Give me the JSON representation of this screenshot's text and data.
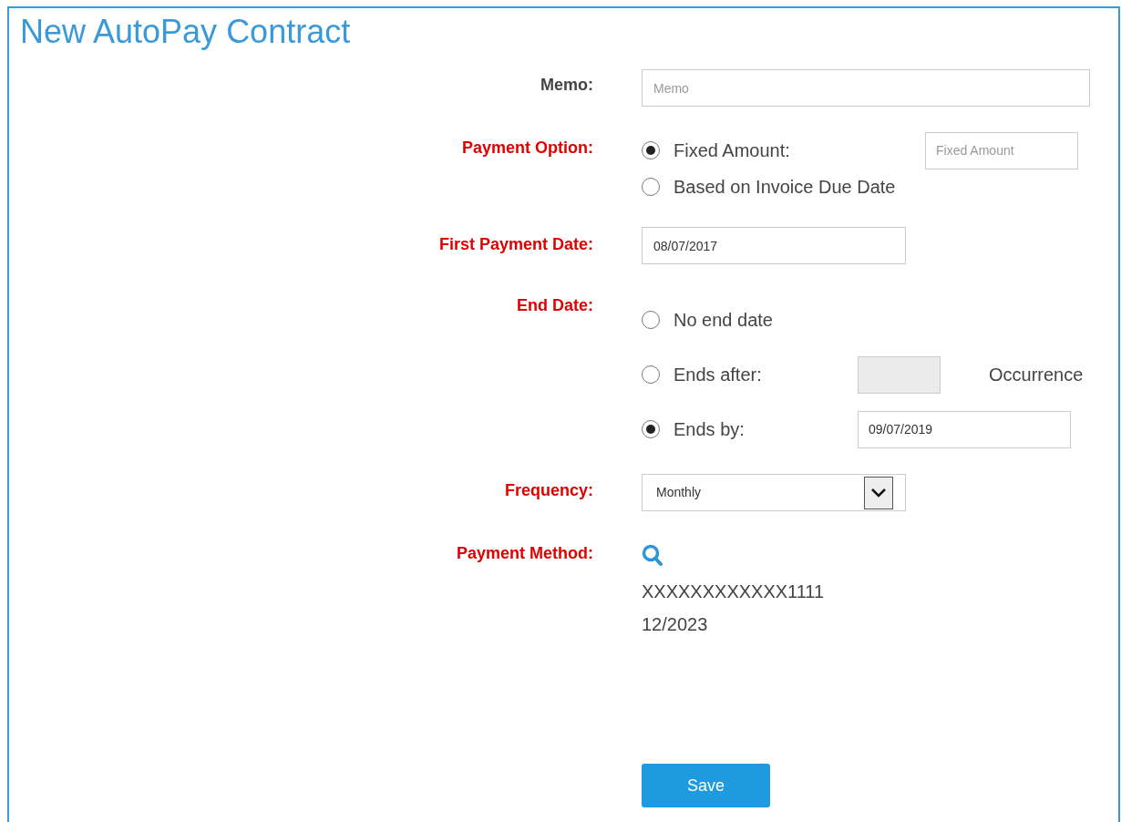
{
  "title": "New AutoPay Contract",
  "fields": [
    {
      "label": "Memo:",
      "required": false,
      "kind": "text",
      "placeholder": "Memo"
    },
    {
      "label": "Payment Option:",
      "required": true,
      "kind": "radios",
      "options": [
        {
          "label": "Fixed Amount:",
          "selected": true,
          "field": {
            "placeholder": "Fixed Amount"
          }
        },
        {
          "label": "Based on Invoice Due Date",
          "selected": false
        }
      ]
    },
    {
      "label": "First Payment Date:",
      "required": true,
      "kind": "text",
      "value": "08/07/2017"
    },
    {
      "label": "End Date:",
      "required": true,
      "kind": "radios",
      "options": [
        {
          "label": "No end date",
          "selected": false
        },
        {
          "label": "Ends after:",
          "selected": false,
          "field": {
            "disabled": true
          },
          "suffix": "Occurrence"
        },
        {
          "label": "Ends by:",
          "selected": true,
          "field": {
            "value": "09/07/2019"
          }
        }
      ]
    },
    {
      "label": "Frequency:",
      "required": true,
      "kind": "select",
      "value": "Monthly"
    },
    {
      "label": "Payment Method:",
      "required": true,
      "kind": "card",
      "lines": [
        "XXXXXXXXXXXX1111",
        "12/2023"
      ]
    }
  ],
  "save": "Save"
}
